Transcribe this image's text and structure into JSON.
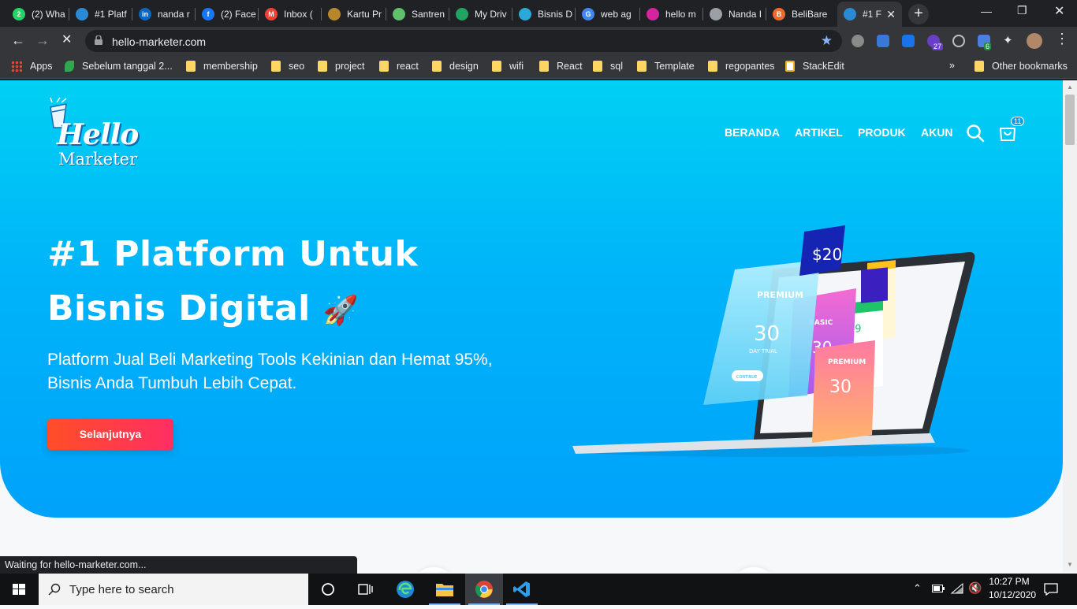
{
  "browser": {
    "tabs": [
      {
        "title": "(2) Wha",
        "color": "#25d366",
        "glyph": "2"
      },
      {
        "title": "#1 Platf",
        "color": "#2a8ad4",
        "glyph": ""
      },
      {
        "title": "nanda r",
        "color": "#0a66c2",
        "glyph": "in"
      },
      {
        "title": "(2) Face",
        "color": "#1877f2",
        "glyph": "f"
      },
      {
        "title": "Inbox (",
        "color": "#ea4335",
        "glyph": "M"
      },
      {
        "title": "Kartu Pr",
        "color": "#b8862b",
        "glyph": ""
      },
      {
        "title": "Santren",
        "color": "#5fbf6a",
        "glyph": ""
      },
      {
        "title": "My Driv",
        "color": "#1fa463",
        "glyph": ""
      },
      {
        "title": "Bisnis D",
        "color": "#2aa8d8",
        "glyph": ""
      },
      {
        "title": "web ag",
        "color": "#4285f4",
        "glyph": "G"
      },
      {
        "title": "hello m",
        "color": "#d6249f",
        "glyph": ""
      },
      {
        "title": "Nanda I",
        "color": "#9aa0a6",
        "glyph": ""
      },
      {
        "title": "BeliBare",
        "color": "#f06a2a",
        "glyph": "B"
      },
      {
        "title": "#1 F",
        "color": "#2a8ad4",
        "glyph": ""
      }
    ],
    "active_tab_index": 13,
    "url": "hello-marketer.com",
    "extension_badges": {
      "first": "27",
      "second": "6"
    },
    "bookmarks": [
      {
        "label": "Apps",
        "type": "apps"
      },
      {
        "label": "Sebelum tanggal 2...",
        "type": "leaf"
      },
      {
        "label": "membership",
        "type": "folder"
      },
      {
        "label": "seo",
        "type": "folder"
      },
      {
        "label": "project",
        "type": "folder"
      },
      {
        "label": "react",
        "type": "folder"
      },
      {
        "label": "design",
        "type": "folder"
      },
      {
        "label": "wifi",
        "type": "folder"
      },
      {
        "label": "React",
        "type": "folder"
      },
      {
        "label": "sql",
        "type": "folder"
      },
      {
        "label": "Template",
        "type": "folder"
      },
      {
        "label": "regopantes",
        "type": "folder"
      },
      {
        "label": "StackEdit",
        "type": "stackedit"
      }
    ],
    "overflow_label": "»",
    "other_bookmarks": "Other bookmarks",
    "status_text": "Waiting for hello-marketer.com..."
  },
  "site": {
    "logo_line1": "Hello",
    "logo_line2": "Marketer",
    "nav": [
      "BERANDA",
      "ARTIKEL",
      "PRODUK",
      "AKUN"
    ],
    "cart_count": "11",
    "hero_title_line1": "#1 Platform Untuk",
    "hero_title_line2": "Bisnis Digital",
    "hero_emoji": "🚀",
    "hero_sub_line1": "Platform Jual Beli Marketing Tools Kekinian dan Hemat 95%,",
    "hero_sub_line2": "Bisnis Anda Tumbuh Lebih Cepat.",
    "cta_label": "Selanjutnya",
    "illustration_texts": {
      "card_price": "$20",
      "premium": "PREMIUM",
      "premium_days": "30",
      "trial": "DAY TRIAL",
      "basic": "BASIC",
      "basic_days": "30",
      "premium2": "PREMIUM",
      "premium2_days": "30",
      "price2": "29",
      "continue": "CONTINUE"
    }
  },
  "taskbar": {
    "search_placeholder": "Type here to search",
    "time": "10:27 PM",
    "date": "10/12/2020"
  },
  "colors": {
    "hero_top": "#00d0f3",
    "hero_bottom": "#00a2fa",
    "cta_start": "#ff4e27",
    "cta_end": "#ff2e63"
  }
}
